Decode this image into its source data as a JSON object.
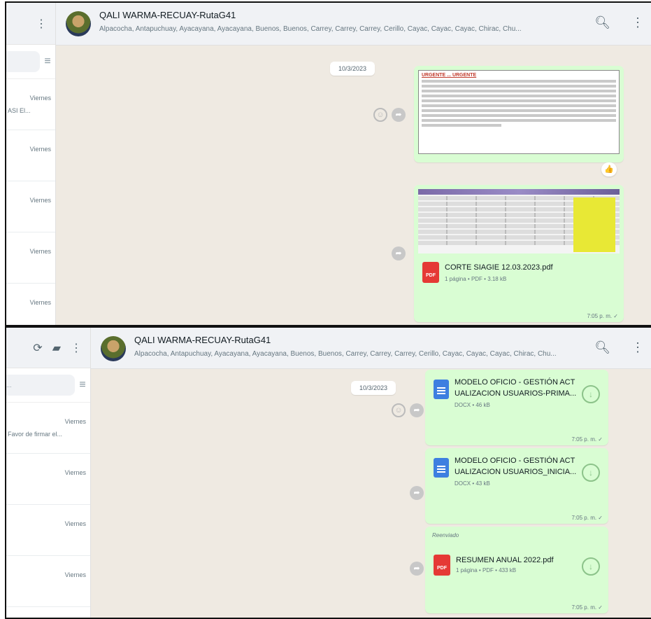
{
  "panel1": {
    "header": {
      "title": "QALI WARMA-RECUAY-RutaG41",
      "members": "Alpacocha, Antapuchuay, Ayacayana, Ayacayana, Buenos, Buenos, Carrey, Carrey, Carrey, Cerillo, Cayac, Cayac, Cayac, Chirac, Chu..."
    },
    "side_chats": [
      {
        "day": "Viernes",
        "preview": "ASI El..."
      },
      {
        "day": "Viernes",
        "preview": ""
      },
      {
        "day": "Viernes",
        "preview": ""
      },
      {
        "day": "Viernes",
        "preview": ""
      },
      {
        "day": "Viernes",
        "preview": ""
      }
    ],
    "date_chip": "10/3/2023",
    "image_msg": {
      "heading": "URGENTE ... URGENTE",
      "reaction": "👍"
    },
    "file_msg": {
      "filename": "CORTE SIAGIE 12.03.2023.pdf",
      "meta": "1 página • PDF • 3.18 kB",
      "time": "7:05 p. m. ✓"
    }
  },
  "panel2": {
    "header": {
      "title": "QALI WARMA-RECUAY-RutaG41",
      "members": "Alpacocha, Antapuchuay, Ayacayana, Ayacayana, Buenos, Buenos, Carrey, Carrey, Carrey, Cerillo, Cayac, Cayac, Cayac, Chirac, Chu..."
    },
    "side_chats": [
      {
        "day": "Viernes",
        "preview": "Favor de firmar el..."
      },
      {
        "day": "Viernes",
        "preview": ""
      },
      {
        "day": "Viernes",
        "preview": ""
      },
      {
        "day": "Viernes",
        "preview": ""
      }
    ],
    "search_placeholder": "...",
    "date_chip": "10/3/2023",
    "docs": [
      {
        "line1": "MODELO OFICIO - GESTIÓN ACT",
        "line2": "UALIZACION USUARIOS-PRIMA...",
        "meta": "DOCX • 46 kB",
        "time": "7:05 p. m. ✓"
      },
      {
        "line1": "MODELO OFICIO - GESTIÓN ACT",
        "line2": "UALIZACION USUARIOS_INICIA...",
        "meta": "DOCX • 43 kB",
        "time": "7:05 p. m. ✓"
      }
    ],
    "forwarded_label": "Reenviado",
    "pdf_doc": {
      "filename": "RESUMEN ANUAL 2022.pdf",
      "meta": "1 página • PDF • 433 kB",
      "time": "7:05 p. m. ✓"
    }
  },
  "icons": {
    "menu": "kebab-menu-icon",
    "search": "search-icon",
    "filter": "filter-icon",
    "forward": "forward-icon",
    "download": "download-icon",
    "communities": "communities-icon",
    "chat": "new-chat-icon"
  },
  "colors": {
    "chat_bg": "#efeae2",
    "outgoing_bubble": "#d9fdd3",
    "pdf_red": "#e53935",
    "doc_blue": "#3d7fe0"
  }
}
